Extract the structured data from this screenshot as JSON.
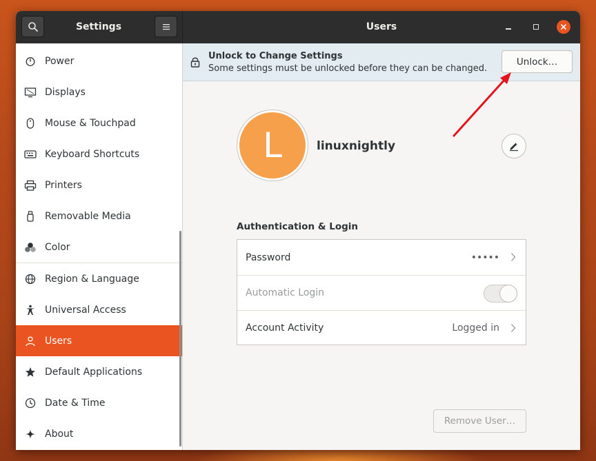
{
  "colors": {
    "accent": "#e95420",
    "avatar_bg": "#f6a04c",
    "headerbar": "#2d2d2d",
    "infobar": "#e3ecf1",
    "annotation_arrow": "#e3141b"
  },
  "headerbar": {
    "sidebar_title": "Settings",
    "panel_title": "Users",
    "search_icon": "search-icon",
    "menu_icon": "hamburger-menu-icon"
  },
  "sidebar": {
    "items": [
      {
        "label": "Power",
        "icon": "power-icon"
      },
      {
        "label": "Displays",
        "icon": "display-icon"
      },
      {
        "label": "Mouse & Touchpad",
        "icon": "mouse-icon"
      },
      {
        "label": "Keyboard Shortcuts",
        "icon": "keyboard-icon"
      },
      {
        "label": "Printers",
        "icon": "printer-icon"
      },
      {
        "label": "Removable Media",
        "icon": "usb-drive-icon"
      },
      {
        "label": "Color",
        "icon": "color-icon"
      },
      {
        "label": "Region & Language",
        "icon": "globe-icon"
      },
      {
        "label": "Universal Access",
        "icon": "accessibility-icon"
      },
      {
        "label": "Users",
        "icon": "users-icon",
        "active": true
      },
      {
        "label": "Default Applications",
        "icon": "star-icon"
      },
      {
        "label": "Date & Time",
        "icon": "clock-icon"
      },
      {
        "label": "About",
        "icon": "sparkle-icon"
      }
    ]
  },
  "infobar": {
    "title": "Unlock to Change Settings",
    "subtitle": "Some settings must be unlocked before they can be changed.",
    "unlock_label": "Unlock…"
  },
  "user": {
    "avatar_letter": "L",
    "username": "linuxnightly"
  },
  "auth": {
    "section_title": "Authentication & Login",
    "password_label": "Password",
    "password_value": "•••••",
    "autologin_label": "Automatic Login",
    "autologin_enabled": false,
    "activity_label": "Account Activity",
    "activity_value": "Logged in"
  },
  "remove_user_label": "Remove User…"
}
